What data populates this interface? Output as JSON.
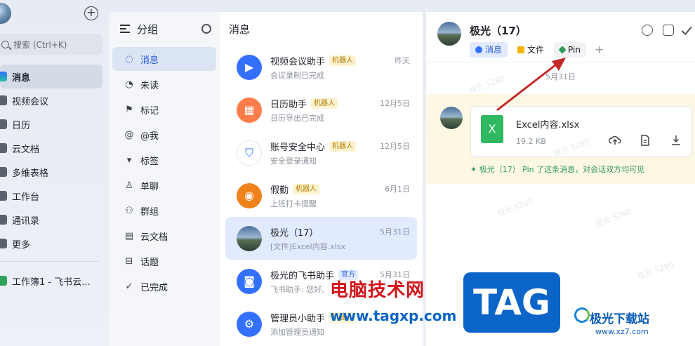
{
  "nav": {
    "search_placeholder": "搜索 (Ctrl+K)",
    "items": [
      {
        "label": "消息"
      },
      {
        "label": "视频会议"
      },
      {
        "label": "日历"
      },
      {
        "label": "云文档"
      },
      {
        "label": "多维表格"
      },
      {
        "label": "工作台"
      },
      {
        "label": "通讯录"
      },
      {
        "label": "更多"
      }
    ],
    "recent_doc": "工作簿1 - 飞书云..."
  },
  "groups": {
    "title": "分组",
    "items": [
      {
        "label": "消息",
        "icon": "chat-bubble-icon"
      },
      {
        "label": "未读",
        "icon": "unread-icon"
      },
      {
        "label": "标记",
        "icon": "flag-icon"
      },
      {
        "label": "@我",
        "icon": "at-icon"
      },
      {
        "label": "标签",
        "icon": "tag-triangle-icon"
      },
      {
        "label": "单聊",
        "icon": "person-icon"
      },
      {
        "label": "群组",
        "icon": "group-icon"
      },
      {
        "label": "云文档",
        "icon": "doc-icon"
      },
      {
        "label": "话题",
        "icon": "topic-icon"
      },
      {
        "label": "已完成",
        "icon": "done-icon"
      }
    ]
  },
  "messages": {
    "title": "消息",
    "conversations": [
      {
        "name": "视频会议助手",
        "tag": "机器人",
        "time": "昨天",
        "preview": "会议录制已完成",
        "color": "#3370ff"
      },
      {
        "name": "日历助手",
        "tag": "机器人",
        "time": "12月5日",
        "preview": "日历导出已完成",
        "color": "#ff7d4a"
      },
      {
        "name": "账号安全中心",
        "tag": "机器人",
        "time": "12月5日",
        "preview": "安全登录通知",
        "color": "#ffffff"
      },
      {
        "name": "假勤",
        "tag": "机器人",
        "time": "6月1日",
        "preview": "上班打卡提醒",
        "color": "#f0821e"
      },
      {
        "name": "极光（17）",
        "tag": "",
        "time": "5月31日",
        "preview": "[文件]Excel内容.xlsx",
        "color": "#5b7ea6"
      },
      {
        "name": "极光的飞书助手",
        "tag": "官方",
        "time": "5月31日",
        "preview": "飞书助手: 您好,",
        "color": "#3370ff"
      },
      {
        "name": "管理员小助手",
        "tag": "机器人",
        "time": "",
        "preview": "添加管理员通知",
        "color": "#3370ff"
      }
    ]
  },
  "chat": {
    "title": "极光（17）",
    "tabs": [
      {
        "label": "消息"
      },
      {
        "label": "文件"
      },
      {
        "label": "Pin"
      }
    ],
    "date": "5月31日",
    "file": {
      "name": "Excel内容.xlsx",
      "size": "19.2 KB",
      "icon_letter": "X"
    },
    "pin_note": "极光（17） Pin 了这条消息，对会话双方均可见"
  },
  "watermarks": {
    "site": "电脑技术网",
    "url": "www.tagxp.com",
    "tag": "TAG",
    "xz_brand": "极光下载站",
    "xz_url": "www.xz7.com",
    "faint": "极光 5280"
  },
  "colors": {
    "accent": "#3370ff",
    "excel": "#2fb85f",
    "pin_green": "#2f9a55",
    "arrow": "#c42828"
  }
}
